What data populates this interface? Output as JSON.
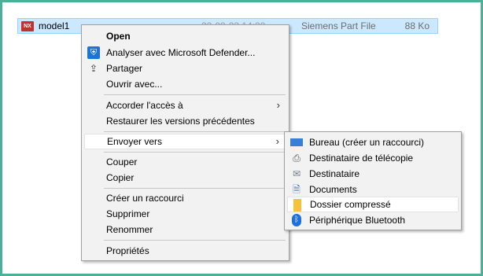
{
  "file": {
    "icon": "nx-icon",
    "icon_text": "NX",
    "name": "model1",
    "date": "22-09-23 14:29",
    "type": "Siemens Part File",
    "size": "88 Ko"
  },
  "context_menu": {
    "items": [
      {
        "label": "Open"
      },
      {
        "label": "Analyser avec Microsoft Defender..."
      },
      {
        "label": "Partager"
      },
      {
        "label": "Ouvrir avec..."
      },
      {
        "label": "Accorder l'accès à"
      },
      {
        "label": "Restaurer les versions précédentes"
      },
      {
        "label": "Envoyer vers"
      },
      {
        "label": "Couper"
      },
      {
        "label": "Copier"
      },
      {
        "label": "Créer un raccourci"
      },
      {
        "label": "Supprimer"
      },
      {
        "label": "Renommer"
      },
      {
        "label": "Propriétés"
      }
    ]
  },
  "send_to_menu": {
    "items": [
      {
        "label": "Bureau (créer un raccourci)"
      },
      {
        "label": "Destinataire de télécopie"
      },
      {
        "label": "Destinataire"
      },
      {
        "label": "Documents"
      },
      {
        "label": "Dossier compressé"
      },
      {
        "label": "Périphérique Bluetooth"
      }
    ]
  },
  "glyphs": {
    "arrow": "›",
    "defender": "⛨",
    "share": "⇪",
    "fax": "⎙",
    "mail": "✉",
    "docs": "🗎",
    "bt": "ᛒ"
  },
  "colors": {
    "frame": "#4fae97",
    "selection": "#cce8ff",
    "menu_bg": "#f2f2f2",
    "highlight": "#ffffff"
  }
}
